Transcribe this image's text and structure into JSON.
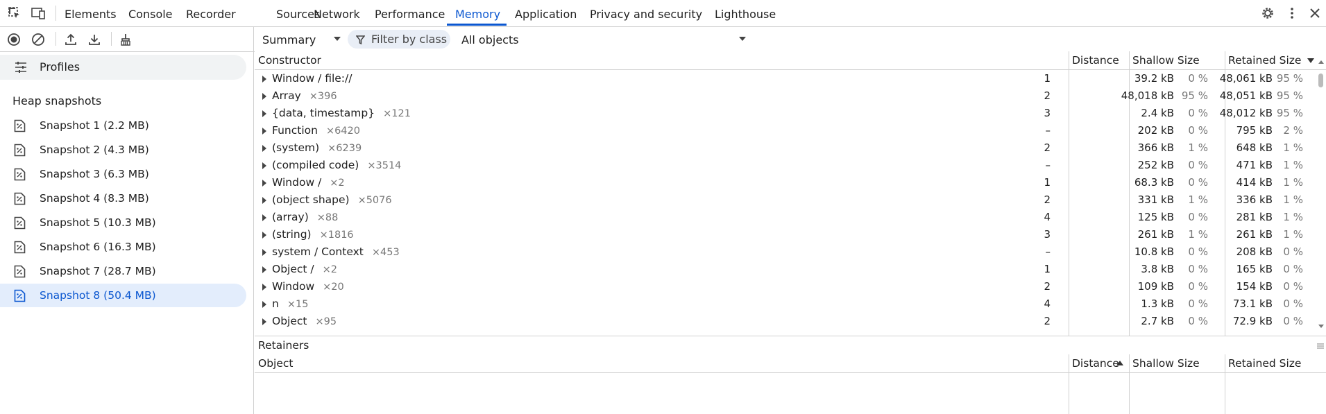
{
  "top_tabs": [
    "Elements",
    "Console",
    "Recorder",
    "Sources",
    "Network",
    "Performance",
    "Memory",
    "Application",
    "Privacy and security",
    "Lighthouse"
  ],
  "active_tab": "Memory",
  "accent_color": "#0b57d0",
  "toolbar": {
    "summary": "Summary",
    "filter_placeholder": "Filter by class",
    "objects_filter": "All objects"
  },
  "sidebar": {
    "profiles_label": "Profiles",
    "heap_title": "Heap snapshots",
    "snapshots": [
      "Snapshot 1 (2.2 MB)",
      "Snapshot 2 (4.3 MB)",
      "Snapshot 3 (6.3 MB)",
      "Snapshot 4 (8.3 MB)",
      "Snapshot 5 (10.3 MB)",
      "Snapshot 6 (16.3 MB)",
      "Snapshot 7 (28.7 MB)",
      "Snapshot 8 (50.4 MB)"
    ],
    "selected": "Snapshot 8 (50.4 MB)"
  },
  "grid": {
    "headers": {
      "constructor": "Constructor",
      "distance": "Distance",
      "shallow": "Shallow Size",
      "retained": "Retained Size"
    },
    "sort": "Retained Size descending",
    "rows": [
      {
        "name": "Window / file://",
        "count": "",
        "distance": "1",
        "shallow": "39.2 kB",
        "shallow_pct": "0 %",
        "retained": "48,061 kB",
        "retained_pct": "95 %"
      },
      {
        "name": "Array",
        "count": "×396",
        "distance": "2",
        "shallow": "48,018 kB",
        "shallow_pct": "95 %",
        "retained": "48,051 kB",
        "retained_pct": "95 %"
      },
      {
        "name": "{data, timestamp}",
        "count": "×121",
        "distance": "3",
        "shallow": "2.4 kB",
        "shallow_pct": "0 %",
        "retained": "48,012 kB",
        "retained_pct": "95 %"
      },
      {
        "name": "Function",
        "count": "×6420",
        "distance": "–",
        "shallow": "202 kB",
        "shallow_pct": "0 %",
        "retained": "795 kB",
        "retained_pct": "2 %"
      },
      {
        "name": "(system)",
        "count": "×6239",
        "distance": "2",
        "shallow": "366 kB",
        "shallow_pct": "1 %",
        "retained": "648 kB",
        "retained_pct": "1 %"
      },
      {
        "name": "(compiled code)",
        "count": "×3514",
        "distance": "–",
        "shallow": "252 kB",
        "shallow_pct": "0 %",
        "retained": "471 kB",
        "retained_pct": "1 %"
      },
      {
        "name": "Window /",
        "count": "×2",
        "distance": "1",
        "shallow": "68.3 kB",
        "shallow_pct": "0 %",
        "retained": "414 kB",
        "retained_pct": "1 %"
      },
      {
        "name": "(object shape)",
        "count": "×5076",
        "distance": "2",
        "shallow": "331 kB",
        "shallow_pct": "1 %",
        "retained": "336 kB",
        "retained_pct": "1 %"
      },
      {
        "name": "(array)",
        "count": "×88",
        "distance": "4",
        "shallow": "125 kB",
        "shallow_pct": "0 %",
        "retained": "281 kB",
        "retained_pct": "1 %"
      },
      {
        "name": "(string)",
        "count": "×1816",
        "distance": "3",
        "shallow": "261 kB",
        "shallow_pct": "1 %",
        "retained": "261 kB",
        "retained_pct": "1 %"
      },
      {
        "name": "system / Context",
        "count": "×453",
        "distance": "–",
        "shallow": "10.8 kB",
        "shallow_pct": "0 %",
        "retained": "208 kB",
        "retained_pct": "0 %"
      },
      {
        "name": "Object /",
        "count": "×2",
        "distance": "1",
        "shallow": "3.8 kB",
        "shallow_pct": "0 %",
        "retained": "165 kB",
        "retained_pct": "0 %"
      },
      {
        "name": "Window",
        "count": "×20",
        "distance": "2",
        "shallow": "109 kB",
        "shallow_pct": "0 %",
        "retained": "154 kB",
        "retained_pct": "0 %"
      },
      {
        "name": "n",
        "count": "×15",
        "distance": "4",
        "shallow": "1.3 kB",
        "shallow_pct": "0 %",
        "retained": "73.1 kB",
        "retained_pct": "0 %"
      },
      {
        "name": "Object",
        "count": "×95",
        "distance": "2",
        "shallow": "2.7 kB",
        "shallow_pct": "0 %",
        "retained": "72.9 kB",
        "retained_pct": "0 %"
      }
    ]
  },
  "retainers": {
    "title": "Retainers",
    "headers": {
      "object": "Object",
      "distance": "Distance",
      "shallow": "Shallow Size",
      "retained": "Retained Size"
    },
    "sort": "Distance ascending"
  }
}
